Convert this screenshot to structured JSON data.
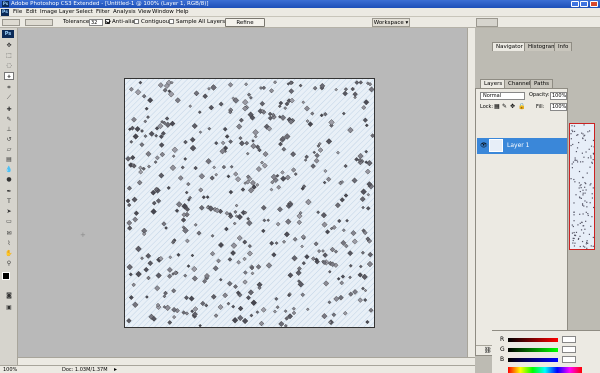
{
  "app": {
    "window_title": "Adobe Photoshop CS3 Extended - [Untitled-1 @ 100% (Layer 1, RGB/8)]",
    "logo_text": "Ps"
  },
  "menus": [
    "File",
    "Edit",
    "Image",
    "Layer",
    "Select",
    "Filter",
    "Analysis",
    "View",
    "Window",
    "Help"
  ],
  "options_bar": {
    "tolerance_label": "Tolerance:",
    "tolerance_value": "32",
    "anti_alias": {
      "label": "Anti-alias",
      "checked": true
    },
    "contiguous": {
      "label": "Contiguous",
      "checked": false
    },
    "sample_all_layers": {
      "label": "Sample All Layers",
      "checked": false
    },
    "refine_edge_label": "Refine Edge...",
    "workspace_label": "Workspace ▾"
  },
  "panels": {
    "top_tabs": [
      "Navigator ×",
      "Histogram",
      "Info"
    ],
    "layers_tabs": [
      "Layers ×",
      "Channels",
      "Paths"
    ],
    "blend_mode": "Normal",
    "opacity_label": "Opacity:",
    "opacity_value": "100%",
    "lock_label": "Lock:",
    "fill_label": "Fill:",
    "fill_value": "100%",
    "layer_name": "Layer 1",
    "color_sliders": [
      "R",
      "G",
      "B"
    ]
  },
  "status": {
    "zoom": "100%",
    "doc_size": "Doc: 1.03M/1.37M"
  },
  "colors": {
    "titlebar": "#1c4fb8",
    "selected_layer": "#3a87d9",
    "canvas_bg": "#b9b9b9",
    "document_bg": "#e9f0f7"
  }
}
